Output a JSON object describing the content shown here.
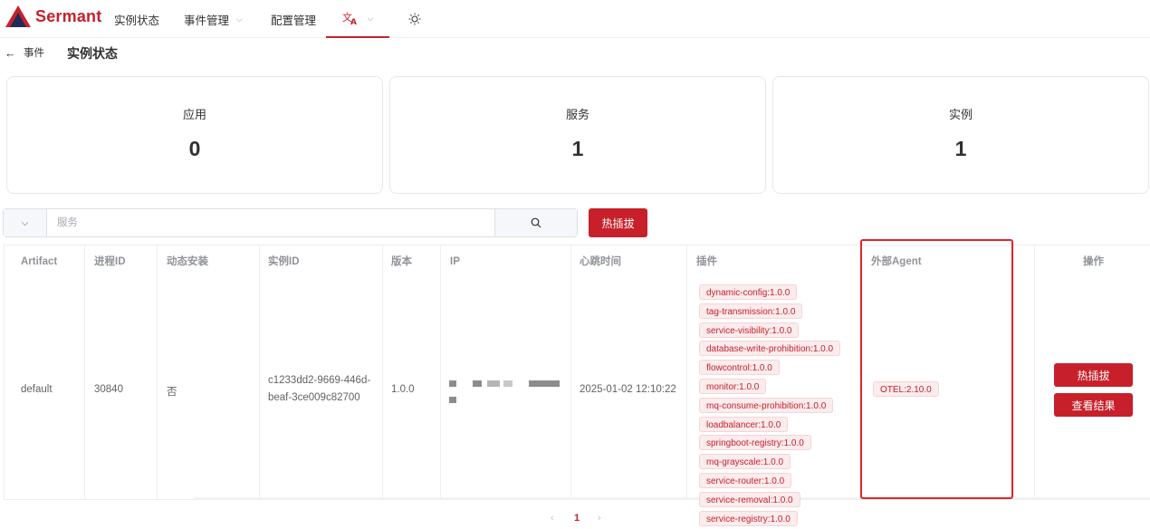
{
  "app": {
    "name": "Sermant",
    "brand_color": "#c7202a"
  },
  "nav": {
    "items": [
      {
        "label": "实例状态"
      },
      {
        "label": "事件管理",
        "has_dropdown": true
      },
      {
        "label": "配置管理"
      }
    ],
    "lang_icon": "translate-icon",
    "theme_icon": "sun-icon"
  },
  "header": {
    "back_label": "事件",
    "title": "实例状态"
  },
  "stats": [
    {
      "label": "应用",
      "value": "0"
    },
    {
      "label": "服务",
      "value": "1"
    },
    {
      "label": "实例",
      "value": "1"
    }
  ],
  "search": {
    "placeholder": "服务",
    "value": "",
    "hot_button": "热插拔"
  },
  "table": {
    "headers": [
      "Artifact",
      "进程ID",
      "动态安装",
      "实例ID",
      "版本",
      "IP",
      "心跳时间",
      "插件",
      "外部Agent",
      "操作"
    ],
    "row": {
      "artifact": "default",
      "pid": "30840",
      "dynamic": "否",
      "instance_id_1": "c1233dd2-9669-446d-",
      "instance_id_2": "beaf-3ce009c82700",
      "version": "1.0.0",
      "heartbeat": "2025-01-02 12:10:22",
      "plugins": [
        "dynamic-config:1.0.0",
        "tag-transmission:1.0.0",
        "service-visibility:1.0.0",
        "database-write-prohibition:1.0.0",
        "flowcontrol:1.0.0",
        "monitor:1.0.0",
        "mq-consume-prohibition:1.0.0",
        "loadbalancer:1.0.0",
        "springboot-registry:1.0.0",
        "mq-grayscale:1.0.0",
        "service-router:1.0.0",
        "service-removal:1.0.0",
        "service-registry:1.0.0"
      ],
      "external_agent": "OTEL:2.10.0",
      "actions": [
        "热插拔",
        "查看结果"
      ]
    }
  },
  "pagination": {
    "prev": "‹",
    "current": "1",
    "next": "›"
  }
}
